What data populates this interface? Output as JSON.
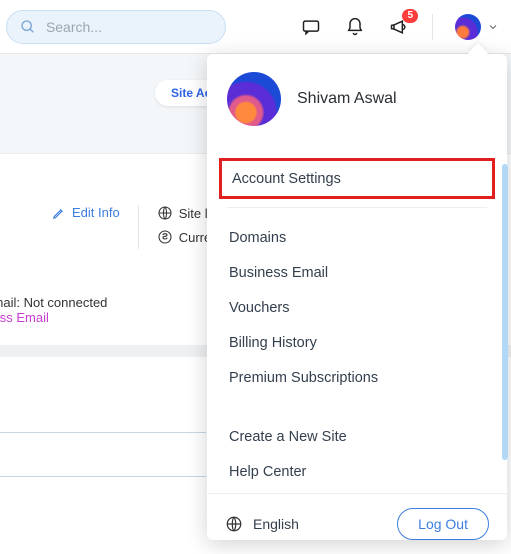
{
  "topbar": {
    "search_placeholder": "Search...",
    "notif_badge": "5"
  },
  "band": {
    "site_actions": "Site Acti"
  },
  "mid": {
    "edit_info": "Edit Info",
    "site_label": "Site la",
    "currency_label": "Curre"
  },
  "email": {
    "status": "ess Email: Not connected",
    "cta": " Business Email"
  },
  "user": {
    "name": "Shivam Aswal"
  },
  "menu": {
    "account_settings": "Account Settings",
    "domains": "Domains",
    "business_email": "Business Email",
    "vouchers": "Vouchers",
    "billing_history": "Billing History",
    "premium_subs": "Premium Subscriptions",
    "create_site": "Create a New Site",
    "help_center": "Help Center"
  },
  "footer": {
    "language": "English",
    "logout": "Log Out"
  }
}
